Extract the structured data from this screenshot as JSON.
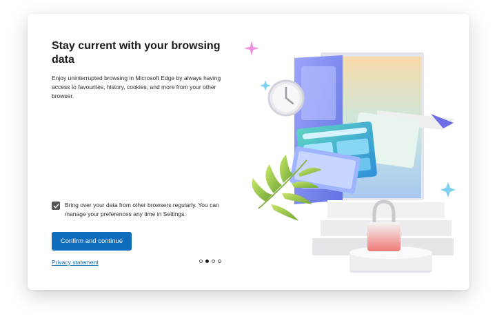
{
  "dialog": {
    "title": "Stay current with your browsing data",
    "description": "Enjoy uninterrupted browsing in Microsoft Edge by always having access to favourites, history, cookies, and more from your other browser.",
    "checkbox": {
      "checked": true,
      "label": "Bring over your data from other browsers regularly. You can manage your preferences any time in Settings."
    },
    "confirm_label": "Confirm and continue",
    "privacy_label": "Privacy statement",
    "pagination": {
      "total": 4,
      "active_index": 1
    }
  },
  "colors": {
    "accent": "#0f6cbd",
    "checkbox": "#555555"
  },
  "icons": {
    "checkmark": "checkmark-icon",
    "illustration": "sync-data-illustration"
  }
}
